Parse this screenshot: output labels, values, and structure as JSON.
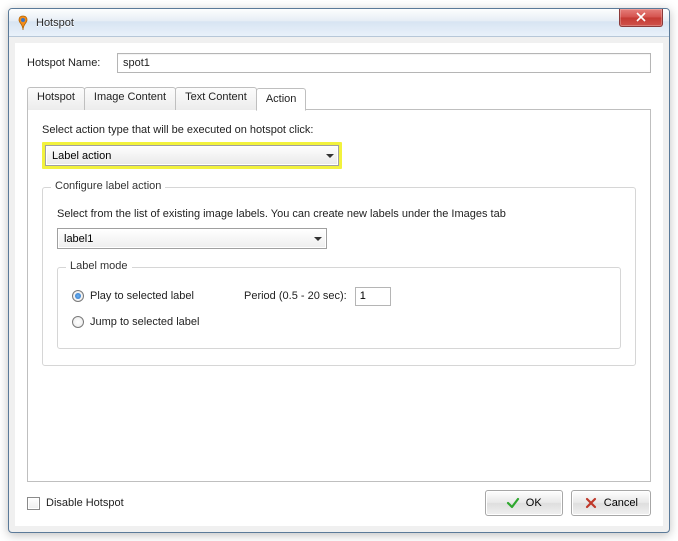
{
  "window": {
    "title": "Hotspot"
  },
  "nameRow": {
    "label": "Hotspot Name:",
    "value": "spot1"
  },
  "tabs": {
    "hotspot": "Hotspot",
    "imageContent": "Image Content",
    "textContent": "Text Content",
    "action": "Action"
  },
  "actionPane": {
    "prompt": "Select action type that will be executed on hotspot click:",
    "actionType": "Label action",
    "configure": {
      "legend": "Configure label action",
      "hint": "Select from the list of existing image labels. You can create new labels under the Images tab",
      "selectedLabel": "label1",
      "labelMode": {
        "legend": "Label mode",
        "playOption": "Play to selected label",
        "jumpOption": "Jump to selected label",
        "periodLabel": "Period (0.5 - 20 sec):",
        "periodValue": "1"
      }
    }
  },
  "footer": {
    "disable": "Disable Hotspot",
    "ok": "OK",
    "cancel": "Cancel"
  }
}
